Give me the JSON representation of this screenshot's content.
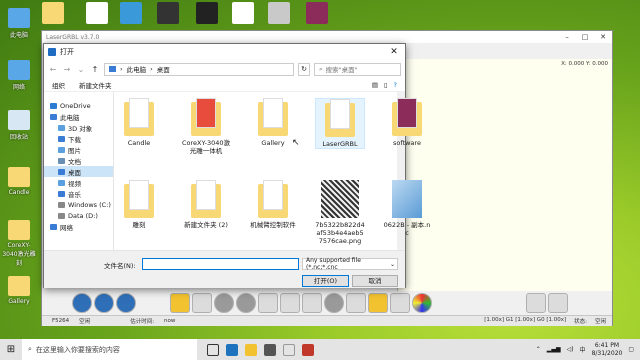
{
  "desktop": {
    "icons": [
      "此电脑",
      "网络",
      "回收站",
      "Candle",
      "CoreXY-3040激光雕刻",
      "Gallery"
    ]
  },
  "lasergrbl": {
    "title": "LaserGRBL v3.7.0",
    "coords": "X: 0.000 Y: 0.000",
    "status": {
      "line": "F5264",
      "estimate_label": "估计时间:",
      "estimate_value": "now",
      "left_label": "空闲",
      "speed": "[1.00x] G1 [1.00x] G0 [1.00x]",
      "state_label": "状态:",
      "state_value": "空闲"
    }
  },
  "dialog": {
    "title": "打开",
    "breadcrumb": [
      "此电脑",
      "桌面"
    ],
    "search_placeholder": "搜索\"桌面\"",
    "toolbar": {
      "organize": "组织",
      "new_folder": "新建文件夹"
    },
    "tree": [
      {
        "label": "OneDrive",
        "sub": false,
        "color": "#2b7cd3"
      },
      {
        "label": "此电脑",
        "sub": false,
        "color": "#3a7bd5"
      },
      {
        "label": "3D 对象",
        "sub": true,
        "color": "#5aa0e0"
      },
      {
        "label": "下载",
        "sub": true,
        "color": "#3a7bd5"
      },
      {
        "label": "图片",
        "sub": true,
        "color": "#5aa0e0"
      },
      {
        "label": "文档",
        "sub": true,
        "color": "#6a8fb5"
      },
      {
        "label": "桌面",
        "sub": true,
        "color": "#3a7bd5",
        "selected": true
      },
      {
        "label": "视频",
        "sub": true,
        "color": "#5aa0e0"
      },
      {
        "label": "音乐",
        "sub": true,
        "color": "#3a7bd5"
      },
      {
        "label": "Windows (C:)",
        "sub": true,
        "color": "#888888"
      },
      {
        "label": "Data (D:)",
        "sub": true,
        "color": "#888888"
      },
      {
        "label": "网络",
        "sub": false,
        "color": "#3a7bd5"
      }
    ],
    "files": [
      {
        "label": "Candle",
        "kind": "folder"
      },
      {
        "label": "CoreXY-3040激光雕一体机",
        "kind": "folder"
      },
      {
        "label": "Gallery",
        "kind": "folder"
      },
      {
        "label": "LaserGRBL",
        "kind": "folder"
      },
      {
        "label": "software",
        "kind": "folder"
      },
      {
        "label": "雕刻",
        "kind": "folder"
      },
      {
        "label": "新建文件夹 (2)",
        "kind": "folder"
      },
      {
        "label": "机械臂控制软件",
        "kind": "folder"
      },
      {
        "label": "7b5322b822d4af53b4e4aeb57576cae.png",
        "kind": "image"
      },
      {
        "label": "0622B - 副本.nc",
        "kind": "nc"
      }
    ],
    "filename_label": "文件名(N):",
    "filename_value": "",
    "filetype": "Any supported file (*.nc;*.cnc",
    "open_button": "打开(O)",
    "cancel_button": "取消"
  },
  "taskbar": {
    "search_placeholder": "在这里输入你要搜索的内容",
    "ime": "中",
    "time": "6:41 PM",
    "date": "8/31/2020"
  },
  "colors": {
    "accent": "#0078d7",
    "folder": "#f8d775",
    "selection": "#cce4f7"
  }
}
